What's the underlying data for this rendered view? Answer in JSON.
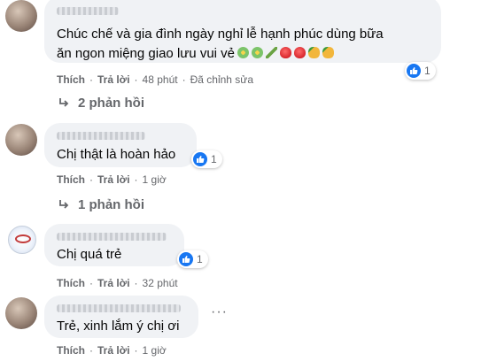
{
  "comments": [
    {
      "text_lines": [
        "Chúc chế và gia đình ngày nghỉ lễ hạnh phúc dùng bữa",
        "ăn ngon miệng giao lưu vui vẻ"
      ],
      "emojis": [
        "flower",
        "flower",
        "stick",
        "berry",
        "berry",
        "pine",
        "pine"
      ],
      "reaction_count": "1",
      "actions": {
        "like": "Thích",
        "reply": "Trả lời",
        "time": "48 phút",
        "edited": "Đã chỉnh sửa"
      },
      "replies_label": "2 phản hồi"
    },
    {
      "text": "Chị thật là hoàn hảo",
      "reaction_count": "1",
      "actions": {
        "like": "Thích",
        "reply": "Trả lời",
        "time": "1 giờ"
      },
      "replies_label": "1 phản hồi"
    },
    {
      "text": "Chị quá trẻ",
      "reaction_count": "1",
      "actions": {
        "like": "Thích",
        "reply": "Trả lời",
        "time": "32 phút"
      }
    },
    {
      "text": "Trẻ, xinh lắm ý chị ơi",
      "actions": {
        "like": "Thích",
        "reply": "Trả lời",
        "time": "1 giờ"
      },
      "more_label": "···"
    }
  ],
  "colors": {
    "like_blue": "#1877f2",
    "bubble": "#f0f2f5",
    "meta": "#65676b"
  },
  "icons": {
    "reaction": "like-icon",
    "reply_arrow": "reply-arrow-icon",
    "more": "more-options-icon"
  }
}
